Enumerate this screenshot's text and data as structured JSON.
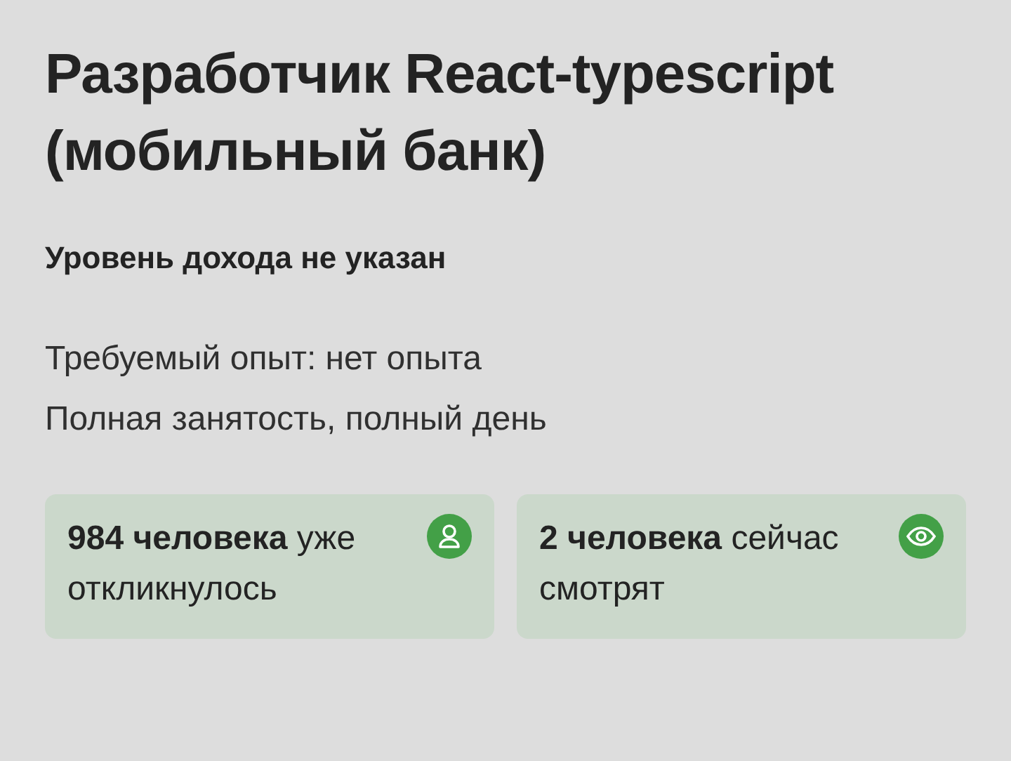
{
  "title": "Разработчик React-typescript (мобильный банк)",
  "salary": "Уровень дохода не указан",
  "details": [
    "Требуемый опыт: нет опыта",
    "Полная занятость, полный день"
  ],
  "stats": [
    {
      "kind": "responses",
      "text": "**984 человека** уже откликнулось"
    },
    {
      "kind": "viewers",
      "text": "**2 человека** сейчас смотрят"
    }
  ]
}
